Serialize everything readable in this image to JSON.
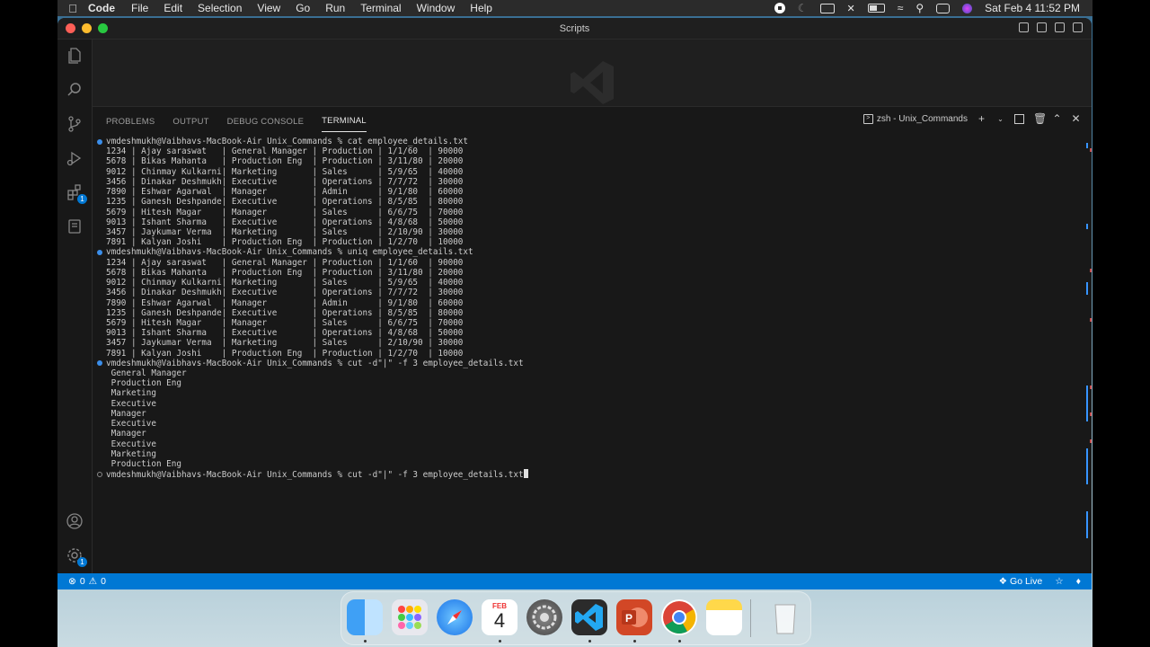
{
  "menubar": {
    "app_name": "Code",
    "menus": [
      "File",
      "Edit",
      "Selection",
      "View",
      "Go",
      "Run",
      "Terminal",
      "Window",
      "Help"
    ],
    "clock": "Sat Feb 4  11:52 PM"
  },
  "window": {
    "title": "Scripts"
  },
  "panel": {
    "tabs": [
      "PROBLEMS",
      "OUTPUT",
      "DEBUG CONSOLE",
      "TERMINAL"
    ],
    "active_tab": "TERMINAL",
    "terminal_instance": "zsh - Unix_Commands"
  },
  "terminal": {
    "lines": [
      {
        "t": "vmdeshmukh@Vaibhavs-MacBook-Air Unix_Commands % cat employee_details.txt",
        "dot": "filled"
      },
      {
        "t": "1234 | Ajay saraswat   | General Manager | Production | 1/1/60  | 90000"
      },
      {
        "t": "5678 | Bikas Mahanta   | Production Eng  | Production | 3/11/80 | 20000"
      },
      {
        "t": "9012 | Chinmay Kulkarni| Marketing       | Sales      | 5/9/65  | 40000"
      },
      {
        "t": "3456 | Dinakar Deshmukh| Executive       | Operations | 7/7/72  | 30000"
      },
      {
        "t": "7890 | Eshwar Agarwal  | Manager         | Admin      | 9/1/80  | 60000"
      },
      {
        "t": "1235 | Ganesh Deshpande| Executive       | Operations | 8/5/85  | 80000"
      },
      {
        "t": "5679 | Hitesh Magar    | Manager         | Sales      | 6/6/75  | 70000"
      },
      {
        "t": "9013 | Ishant Sharma   | Executive       | Operations | 4/8/68  | 50000"
      },
      {
        "t": "3457 | Jaykumar Verma  | Marketing       | Sales      | 2/10/90 | 30000"
      },
      {
        "t": "7891 | Kalyan Joshi    | Production Eng  | Production | 1/2/70  | 10000"
      },
      {
        "t": "vmdeshmukh@Vaibhavs-MacBook-Air Unix_Commands % uniq employee_details.txt",
        "dot": "filled"
      },
      {
        "t": "1234 | Ajay saraswat   | General Manager | Production | 1/1/60  | 90000"
      },
      {
        "t": "5678 | Bikas Mahanta   | Production Eng  | Production | 3/11/80 | 20000"
      },
      {
        "t": "9012 | Chinmay Kulkarni| Marketing       | Sales      | 5/9/65  | 40000"
      },
      {
        "t": "3456 | Dinakar Deshmukh| Executive       | Operations | 7/7/72  | 30000"
      },
      {
        "t": "7890 | Eshwar Agarwal  | Manager         | Admin      | 9/1/80  | 60000"
      },
      {
        "t": "1235 | Ganesh Deshpande| Executive       | Operations | 8/5/85  | 80000"
      },
      {
        "t": "5679 | Hitesh Magar    | Manager         | Sales      | 6/6/75  | 70000"
      },
      {
        "t": "9013 | Ishant Sharma   | Executive       | Operations | 4/8/68  | 50000"
      },
      {
        "t": "3457 | Jaykumar Verma  | Marketing       | Sales      | 2/10/90 | 30000"
      },
      {
        "t": "7891 | Kalyan Joshi    | Production Eng  | Production | 1/2/70  | 10000"
      },
      {
        "t": "vmdeshmukh@Vaibhavs-MacBook-Air Unix_Commands % cut -d\"|\" -f 3 employee_details.txt",
        "dot": "filled"
      },
      {
        "t": " General Manager"
      },
      {
        "t": " Production Eng"
      },
      {
        "t": " Marketing"
      },
      {
        "t": " Executive"
      },
      {
        "t": " Manager"
      },
      {
        "t": " Executive"
      },
      {
        "t": " Manager"
      },
      {
        "t": " Executive"
      },
      {
        "t": " Marketing"
      },
      {
        "t": " Production Eng"
      },
      {
        "t": "vmdeshmukh@Vaibhavs-MacBook-Air Unix_Commands % cut -d\"|\" -f 3 employee_details.txt",
        "dot": "hollow",
        "cursor": true
      }
    ]
  },
  "statusbar": {
    "errors": "0",
    "warnings": "0",
    "go_live": "Go Live"
  },
  "activity": {
    "extensions_badge": "1",
    "settings_badge": "1"
  },
  "dock": {
    "calendar_month": "FEB",
    "calendar_day": "4"
  },
  "colors": {
    "accent": "#0078d4",
    "terminal_bg": "#181818",
    "text": "#cccccc"
  }
}
